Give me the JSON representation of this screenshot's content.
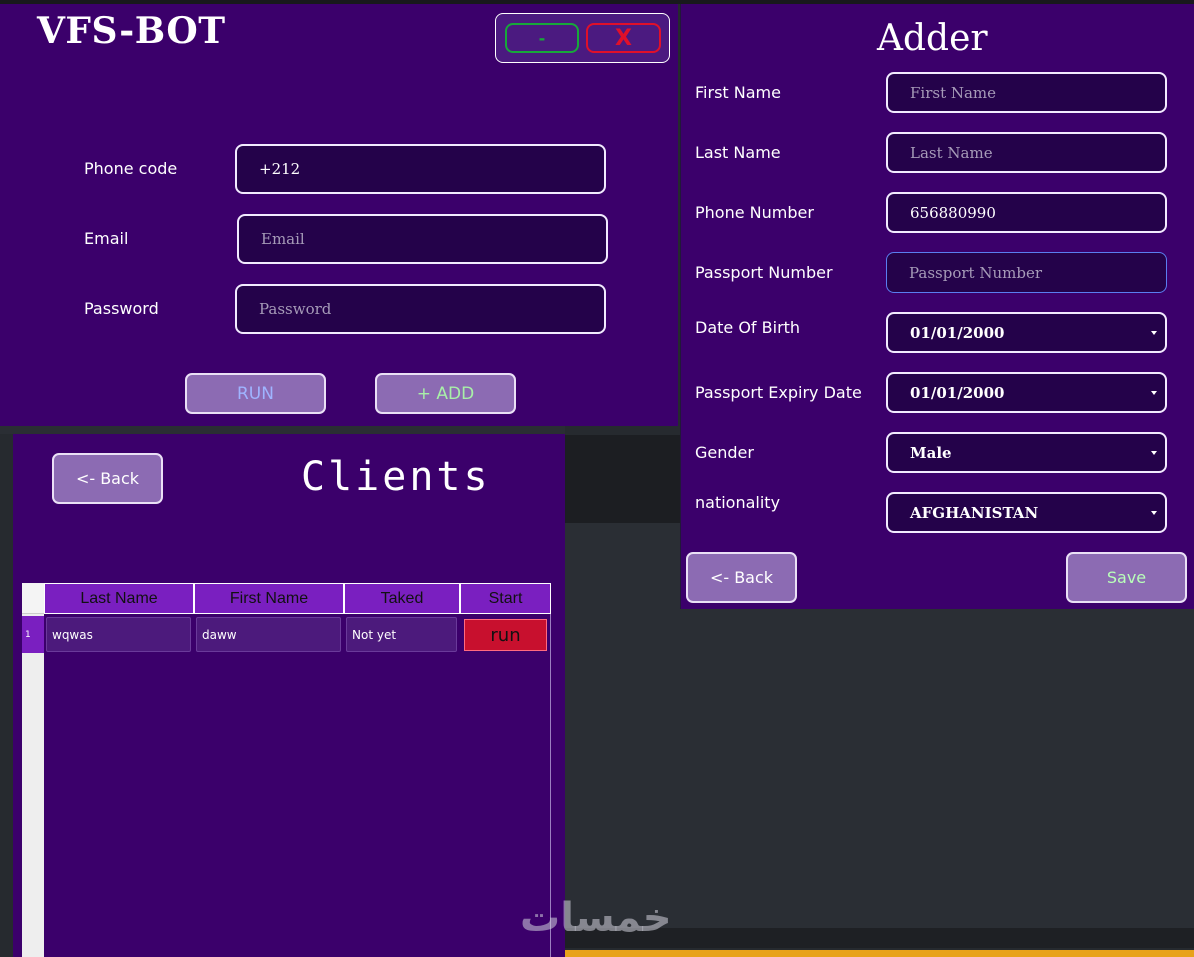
{
  "main": {
    "title": "VFS-BOT",
    "minimize_label": "-",
    "close_label": "X",
    "phone_code_label": "Phone code",
    "phone_code_value": "+212",
    "email_label": "Email",
    "email_placeholder": "Email",
    "password_label": "Password",
    "password_placeholder": "Password",
    "run_label": "RUN",
    "add_label": "+ ADD"
  },
  "adder": {
    "title": "Adder",
    "first_name_label": "First Name",
    "first_name_placeholder": "First Name",
    "last_name_label": "Last Name",
    "last_name_placeholder": "Last Name",
    "phone_number_label": "Phone Number",
    "phone_number_value": "656880990",
    "passport_number_label": "Passport Number",
    "passport_number_placeholder": "Passport Number",
    "dob_label": "Date Of Birth",
    "dob_value": "01/01/2000",
    "expiry_label": "Passport Expiry Date",
    "expiry_value": "01/01/2000",
    "gender_label": "Gender",
    "gender_value": "Male",
    "nationality_label": "nationality",
    "nationality_value": "AFGHANISTAN",
    "back_label": "<- Back",
    "save_label": "Save"
  },
  "clients": {
    "title": "Clients",
    "back_label": "<- Back",
    "columns": [
      "Last Name",
      "First Name",
      "Taked",
      "Start"
    ],
    "rows": [
      {
        "index": "1",
        "last_name": "wqwas",
        "first_name": "daww",
        "taked": "Not yet",
        "start": "run"
      }
    ]
  },
  "watermark": "خمسات",
  "colors": {
    "panel": "#3b006b",
    "field_bg": "#24024a",
    "button_bg": "#8c6bb3",
    "header_bg": "#7a1fc0",
    "run_button": "#c8102e"
  }
}
